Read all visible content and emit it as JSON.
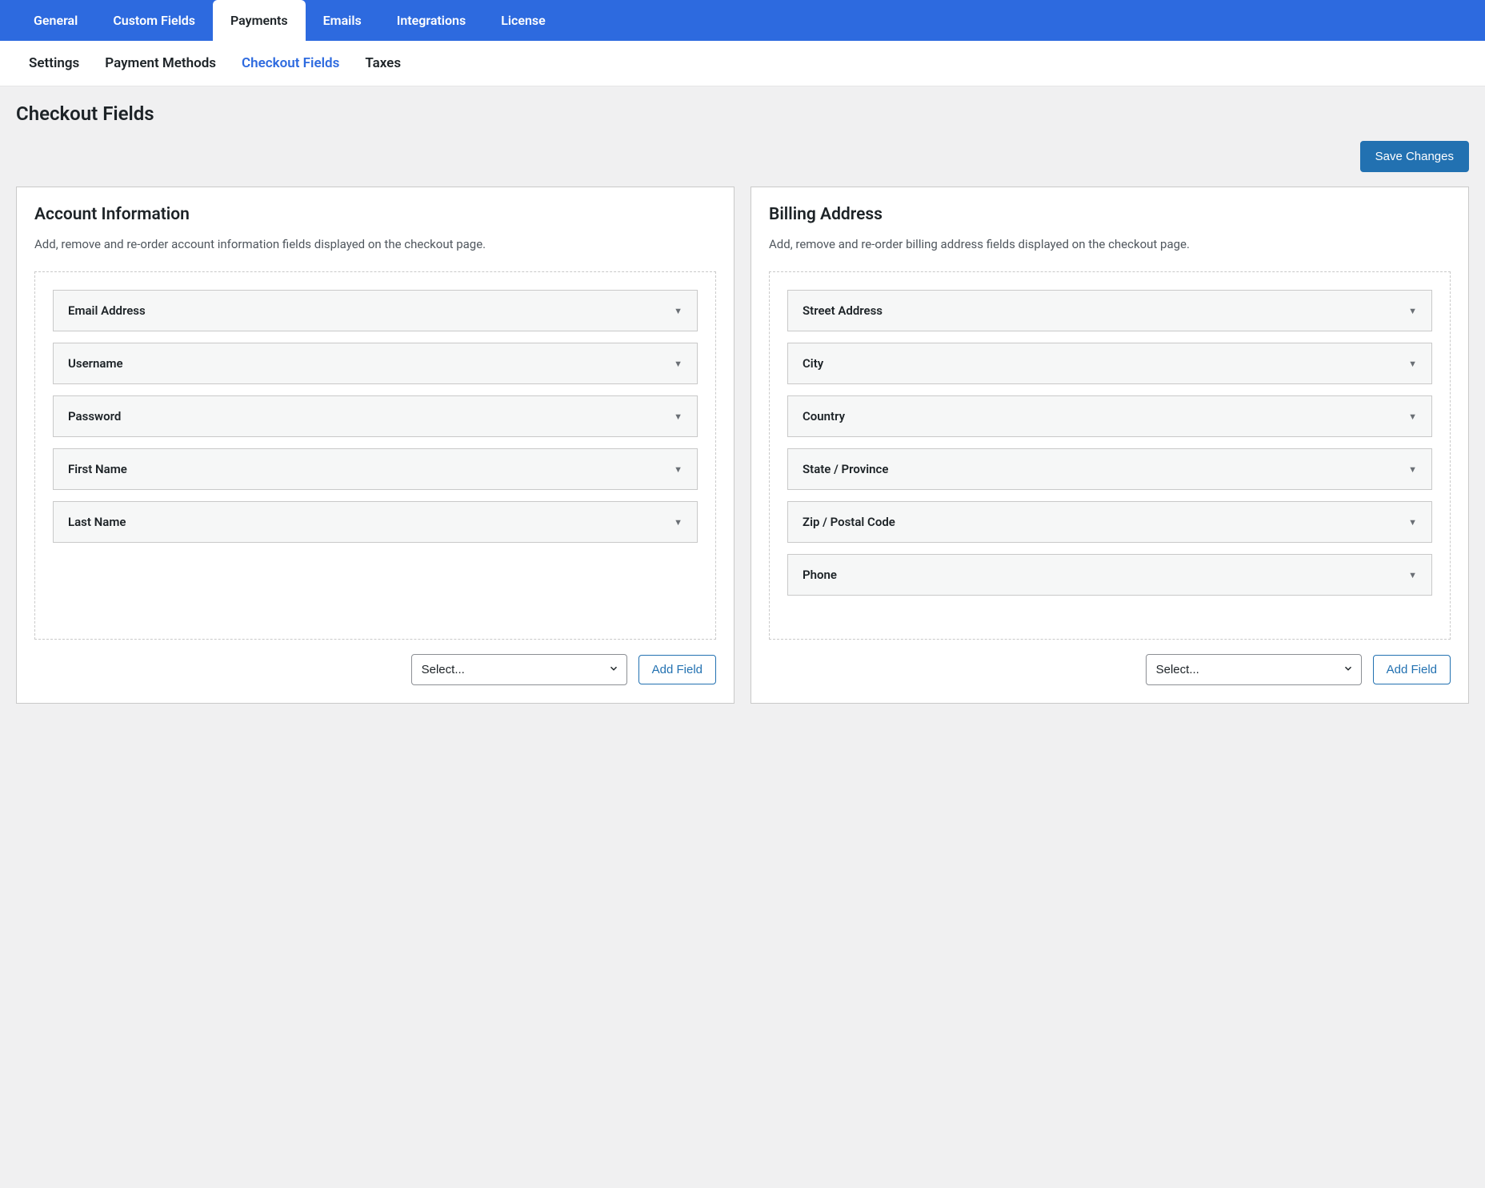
{
  "top_tabs": [
    {
      "label": "General",
      "active": false
    },
    {
      "label": "Custom Fields",
      "active": false
    },
    {
      "label": "Payments",
      "active": true
    },
    {
      "label": "Emails",
      "active": false
    },
    {
      "label": "Integrations",
      "active": false
    },
    {
      "label": "License",
      "active": false
    }
  ],
  "sub_tabs": [
    {
      "label": "Settings",
      "active": false
    },
    {
      "label": "Payment Methods",
      "active": false
    },
    {
      "label": "Checkout Fields",
      "active": true
    },
    {
      "label": "Taxes",
      "active": false
    }
  ],
  "page_title": "Checkout Fields",
  "save_button": "Save Changes",
  "panels": {
    "account": {
      "title": "Account Information",
      "description": "Add, remove and re-order account information fields displayed on the checkout page.",
      "fields": [
        "Email Address",
        "Username",
        "Password",
        "First Name",
        "Last Name"
      ],
      "select_placeholder": "Select...",
      "add_button": "Add Field"
    },
    "billing": {
      "title": "Billing Address",
      "description": "Add, remove and re-order billing address fields displayed on the checkout page.",
      "fields": [
        "Street Address",
        "City",
        "Country",
        "State / Province",
        "Zip / Postal Code",
        "Phone"
      ],
      "select_placeholder": "Select...",
      "add_button": "Add Field"
    }
  }
}
